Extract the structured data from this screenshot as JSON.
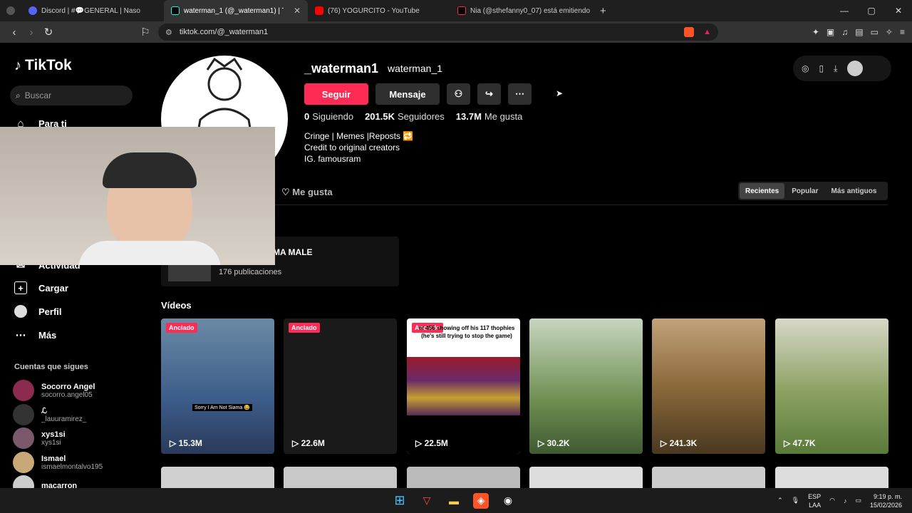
{
  "browser": {
    "tabs": [
      {
        "label": "Discord | #💬GENERAL | Naso",
        "active": false,
        "color": "#5865f2"
      },
      {
        "label": "waterman_1 (@_waterman1) | TikTok",
        "active": true,
        "color": "#000000"
      },
      {
        "label": "(76) YOGURCITO - YouTube",
        "active": false,
        "color": "#ff0000"
      },
      {
        "label": "Nia (@sthefanny0_07) está emitiendo",
        "active": false,
        "color": "#000000"
      }
    ],
    "new_tab": "+",
    "minimize": "—",
    "maximize": "▢",
    "close": "✕",
    "url": "tiktok.com/@_waterman1"
  },
  "sidebar": {
    "logo": "TikTok",
    "search_placeholder": "Buscar",
    "items": [
      {
        "label": "Para ti",
        "icon": "home-icon"
      },
      {
        "label": "Actividad",
        "icon": "inbox-icon"
      },
      {
        "label": "Cargar",
        "icon": "upload-icon"
      },
      {
        "label": "Perfil",
        "icon": "avatar-icon"
      },
      {
        "label": "Más",
        "icon": "more-icon"
      }
    ],
    "following_title": "Cuentas que sigues",
    "following": [
      {
        "name": "Socorro Angel",
        "handle": "socorro.angel05"
      },
      {
        "name": "ℒ",
        "handle": "_lauuramirez_"
      },
      {
        "name": "xys1si",
        "handle": "xys1si"
      },
      {
        "name": "Ismael",
        "handle": "ismaelmontalvo195"
      },
      {
        "name": "macarron",
        "handle": ""
      }
    ]
  },
  "profile": {
    "username": "_waterman1",
    "display_name": "waterman_1",
    "follow_label": "Seguir",
    "message_label": "Mensaje",
    "following_count": "0",
    "following_label": "Siguiendo",
    "followers_count": "201.5K",
    "followers_label": "Seguidores",
    "likes_count": "13.7M",
    "likes_label": "Me gusta",
    "bio": [
      "Cringe | Memes |Reposts 🔁",
      "Credit to original creators",
      "IG. famousram"
    ],
    "tab_likes": "Me gusta",
    "sort": [
      "Recientes",
      "Popular",
      "Más antiguos"
    ],
    "playlist_title": "MA MALE",
    "playlist_count": "176 publicaciones",
    "videos_title": "Vídeos"
  },
  "videos": [
    {
      "pinned": "Anciado",
      "views": "15.3M",
      "caption": "Sorry I Am Not Siama 😂"
    },
    {
      "pinned": "Anclado",
      "views": "22.6M",
      "caption": ""
    },
    {
      "pinned": "Anclado",
      "views": "22.5M",
      "caption": "er 456 showing off his 117 thophies (he's still trying to stop the game)"
    },
    {
      "pinned": "",
      "views": "30.2K",
      "caption": ""
    },
    {
      "pinned": "",
      "views": "241.3K",
      "caption": ""
    },
    {
      "pinned": "",
      "views": "47.7K",
      "caption": ""
    }
  ],
  "taskbar": {
    "lang_top": "ESP",
    "lang_bottom": "LAA",
    "time": "9:19 p. m.",
    "date": "15/02/2026"
  }
}
